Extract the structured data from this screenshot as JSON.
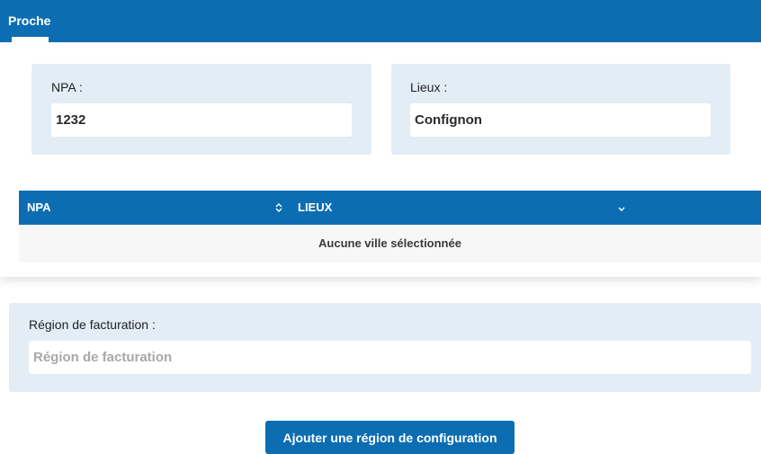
{
  "tabs": [
    {
      "label": "Proche",
      "active": true
    }
  ],
  "fields": {
    "npa": {
      "label": "NPA :",
      "value": "1232"
    },
    "lieux": {
      "label": "Lieux :",
      "value": "Confignon"
    }
  },
  "table": {
    "columns": [
      {
        "label": "NPA",
        "sort_icon": "sort-updown-icon"
      },
      {
        "label": "LIEUX",
        "sort_icon": "chevron-down-icon"
      }
    ],
    "empty_message": "Aucune ville sélectionnée"
  },
  "region": {
    "label": "Région de facturation :",
    "value": "",
    "placeholder": "Région de facturation"
  },
  "actions": {
    "add_region_label": "Ajouter une région de configuration"
  },
  "colors": {
    "primary": "#0d6db3",
    "panel": "#e3edf6",
    "empty_row": "#f7f7f7"
  }
}
